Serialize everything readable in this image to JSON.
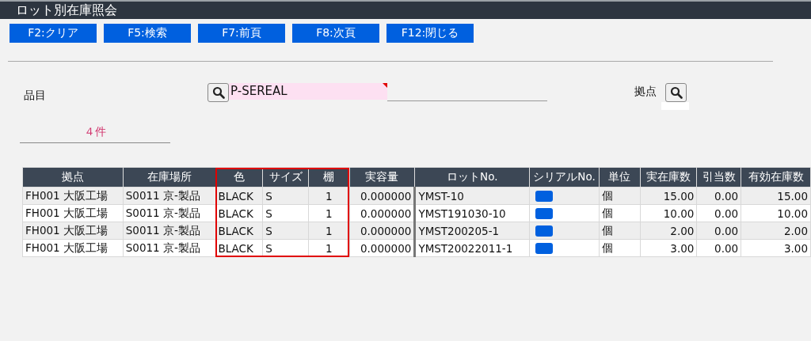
{
  "window": {
    "title": "ロット別在庫照会"
  },
  "function_keys": [
    {
      "label": "F2:クリア"
    },
    {
      "label": "F5:検索"
    },
    {
      "label": "F7:前頁"
    },
    {
      "label": "F8:次頁"
    },
    {
      "label": "F12:閉じる"
    }
  ],
  "item_field": {
    "label": "品目",
    "value": "P-SEREAL",
    "required": true
  },
  "site_field": {
    "label": "拠点"
  },
  "count": "４件",
  "table": {
    "columns": [
      {
        "label": "拠点",
        "highlighted": false,
        "kind": "text"
      },
      {
        "label": "在庫場所",
        "highlighted": false,
        "kind": "text"
      },
      {
        "label": "色",
        "highlighted": true,
        "kind": "text"
      },
      {
        "label": "サイズ",
        "highlighted": true,
        "kind": "text"
      },
      {
        "label": "棚",
        "highlighted": true,
        "kind": "code"
      },
      {
        "label": "実容量",
        "highlighted": false,
        "kind": "number"
      },
      {
        "label": "ロットNo.",
        "highlighted": false,
        "kind": "text"
      },
      {
        "label": "シリアルNo.",
        "highlighted": false,
        "kind": "button"
      },
      {
        "label": "単位",
        "highlighted": false,
        "kind": "text"
      },
      {
        "label": "実在庫数",
        "highlighted": false,
        "kind": "number"
      },
      {
        "label": "引当数",
        "highlighted": false,
        "kind": "number"
      },
      {
        "label": "有効在庫数",
        "highlighted": false,
        "kind": "number"
      }
    ],
    "rows": [
      {
        "cells": [
          "FH001 大阪工場",
          "S0011 京-製品",
          "BLACK",
          "S",
          "1",
          "0.000000",
          "YMST-10",
          true,
          "個",
          "15.00",
          "0.00",
          "15.00"
        ]
      },
      {
        "cells": [
          "FH001 大阪工場",
          "S0011 京-製品",
          "BLACK",
          "S",
          "1",
          "0.000000",
          "YMST191030-10",
          true,
          "個",
          "10.00",
          "0.00",
          "10.00"
        ]
      },
      {
        "cells": [
          "FH001 大阪工場",
          "S0011 京-製品",
          "BLACK",
          "S",
          "1",
          "0.000000",
          "YMST200205-1",
          true,
          "個",
          "2.00",
          "0.00",
          "2.00"
        ]
      },
      {
        "cells": [
          "FH001 大阪工場",
          "S0011 京-製品",
          "BLACK",
          "S",
          "1",
          "0.000000",
          "YMST20022011-1",
          true,
          "個",
          "3.00",
          "0.00",
          "3.00"
        ]
      }
    ]
  }
}
